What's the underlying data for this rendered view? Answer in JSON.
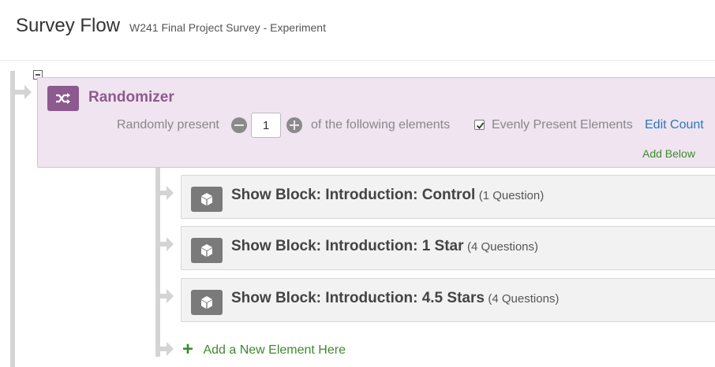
{
  "header": {
    "title": "Survey Flow",
    "survey_name": "W241 Final Project Survey - Experiment"
  },
  "randomizer": {
    "title": "Randomizer",
    "randomly_present_label": "Randomly present",
    "count_value": "1",
    "following_label": "of the following elements",
    "evenly_checked": true,
    "evenly_label": "Evenly Present Elements",
    "edit_count_label": "Edit Count",
    "add_below_label": "Add Below"
  },
  "blocks": [
    {
      "title": "Show Block: Introduction: Control",
      "count": "(1 Question)"
    },
    {
      "title": "Show Block: Introduction: 1 Star",
      "count": "(4 Questions)"
    },
    {
      "title": "Show Block: Introduction: 4.5 Stars",
      "count": "(4 Questions)"
    }
  ],
  "add_element": {
    "plus": "+",
    "label": "Add a New Element Here"
  },
  "colors": {
    "randomizer_bg": "#f0e4f1",
    "randomizer_accent": "#8c5a8e",
    "link_blue": "#2a78b8",
    "action_green": "#3d8b2c",
    "block_bg": "#f2f2f2"
  },
  "icons": {
    "randomizer": "shuffle-icon",
    "block": "cube-icon",
    "collapse": "collapse-minus-icon"
  }
}
